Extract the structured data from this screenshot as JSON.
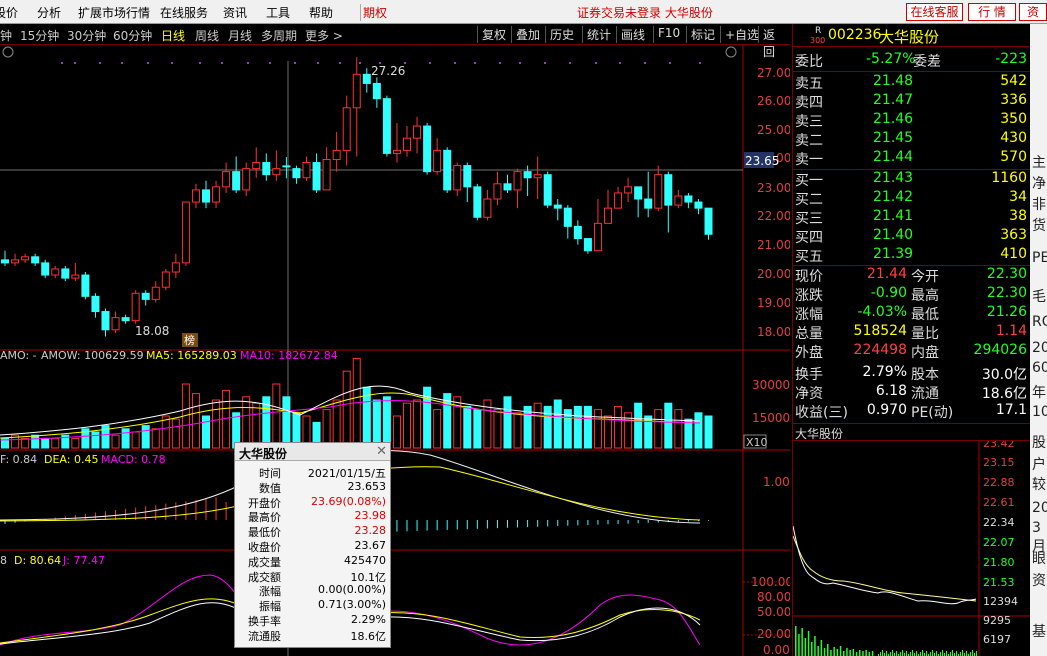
{
  "menu": {
    "items": [
      "股价",
      "分析",
      "扩展市场行情",
      "在线服务",
      "资讯",
      "工具",
      "帮助",
      "期权"
    ],
    "notice": "证券交易未登录 大华股份",
    "online_btn": "在线客服",
    "quote_btn": "行 情",
    "info_btn": "资"
  },
  "periods": [
    "钟",
    "15分钟",
    "30分钟",
    "60分钟",
    "日线",
    "周线",
    "月线",
    "多周期",
    "更多 >"
  ],
  "toolbar": [
    "复权",
    "叠加",
    "历史",
    "统计",
    "画线",
    "F10",
    "标记",
    "+自选",
    "返回"
  ],
  "stock": {
    "code": "002236",
    "name": "大华股份",
    "badge_r": "R",
    "badge_n": "300"
  },
  "order_ratio": {
    "label1": "委比",
    "v1": "-5.27%",
    "label2": "委差",
    "v2": "-223"
  },
  "sell": [
    {
      "label": "卖五",
      "price": "21.48",
      "vol": "542"
    },
    {
      "label": "卖四",
      "price": "21.47",
      "vol": "336"
    },
    {
      "label": "卖三",
      "price": "21.46",
      "vol": "350"
    },
    {
      "label": "卖二",
      "price": "21.45",
      "vol": "430"
    },
    {
      "label": "卖一",
      "price": "21.44",
      "vol": "570"
    }
  ],
  "buy": [
    {
      "label": "买一",
      "price": "21.43",
      "vol": "1160"
    },
    {
      "label": "买二",
      "price": "21.42",
      "vol": "34"
    },
    {
      "label": "买三",
      "price": "21.41",
      "vol": "38"
    },
    {
      "label": "买四",
      "price": "21.40",
      "vol": "363"
    },
    {
      "label": "买五",
      "price": "21.39",
      "vol": "410"
    }
  ],
  "stats": [
    {
      "l1": "现价",
      "v1": "21.44",
      "c1": "#ff4040",
      "l2": "今开",
      "v2": "22.30",
      "c2": "#20ff20"
    },
    {
      "l1": "涨跌",
      "v1": "-0.90",
      "c1": "#20ff20",
      "l2": "最高",
      "v2": "22.30",
      "c2": "#20ff20"
    },
    {
      "l1": "涨幅",
      "v1": "-4.03%",
      "c1": "#20ff20",
      "l2": "最低",
      "v2": "21.26",
      "c2": "#20ff20"
    },
    {
      "l1": "总量",
      "v1": "518524",
      "c1": "#ffff00",
      "l2": "量比",
      "v2": "1.14",
      "c2": "#ff4040"
    },
    {
      "l1": "外盘",
      "v1": "224498",
      "c1": "#ff4040",
      "l2": "内盘",
      "v2": "294026",
      "c2": "#20ff20"
    },
    {
      "l1": "换手",
      "v1": "2.79%",
      "c1": "#ffffff",
      "l2": "股本",
      "v2": "30.0亿",
      "c2": "#ffffff"
    },
    {
      "l1": "净资",
      "v1": "6.18",
      "c1": "#ffffff",
      "l2": "流通",
      "v2": "18.6亿",
      "c2": "#ffffff"
    },
    {
      "l1": "收益(三)",
      "v1": "0.970",
      "c1": "#ffffff",
      "l2": "PE(动)",
      "v2": "17.1",
      "c2": "#ffffff"
    }
  ],
  "mini_title": "大华股份",
  "mini_axis": [
    "23.42",
    "23.15",
    "22.88",
    "22.61",
    "22.34",
    "22.07",
    "21.80",
    "21.53"
  ],
  "mini_vol_axis": [
    "12394",
    "9295",
    "6197"
  ],
  "right_panel": [
    "主",
    "净",
    "非",
    "货",
    "PE",
    "毛",
    "RO",
    "20",
    "60",
    "年",
    "10",
    "股",
    "户",
    "较",
    "20",
    "3月",
    "眼",
    "资",
    "基"
  ],
  "price_axis": [
    "27.00",
    "26.00",
    "25.00",
    "24.00",
    "23.00",
    "22.00",
    "21.00",
    "20.00",
    "19.00",
    "18.00"
  ],
  "cursor_price": "23.65",
  "high_label": "27.26",
  "low_label": "18.08",
  "bang": "榜",
  "vol_header": {
    "name": "AMO: -",
    "amow": "AMOW: 100629.59",
    "ma5": "MA5: 165289.03",
    "ma10": "MA10: 182672.84"
  },
  "vol_axis": [
    "30000",
    "15000"
  ],
  "vol_unit": "X10",
  "macd_header": {
    "dif": "F: 0.84",
    "dea": "DEA: 0.45",
    "macd": "MACD: 0.78"
  },
  "macd_axis": [
    "1.00"
  ],
  "kdj_header": {
    "k": "8",
    "d": "D: 80.64",
    "j": "J: 77.47"
  },
  "kdj_axis": [
    "100.00",
    "80.00",
    "50.00",
    "20.00",
    "0.00"
  ],
  "popup": {
    "title": "大华股份",
    "rows": [
      {
        "k": "时间",
        "v": "2021/01/15/五",
        "c": "#000"
      },
      {
        "k": "数值",
        "v": "23.653",
        "c": "#000"
      },
      {
        "k": "开盘价",
        "v": "23.69(0.08%)",
        "c": "#d00"
      },
      {
        "k": "最高价",
        "v": "23.98",
        "c": "#d00"
      },
      {
        "k": "最低价",
        "v": "23.28",
        "c": "#d00"
      },
      {
        "k": "收盘价",
        "v": "23.67",
        "c": "#000"
      },
      {
        "k": "成交量",
        "v": "425470",
        "c": "#000"
      },
      {
        "k": "成交额",
        "v": "10.1亿",
        "c": "#000"
      },
      {
        "k": "涨幅",
        "v": "0.00(0.00%)",
        "c": "#000"
      },
      {
        "k": "振幅",
        "v": "0.71(3.00%)",
        "c": "#000"
      },
      {
        "k": "换手率",
        "v": "2.29%",
        "c": "#000"
      },
      {
        "k": "流通股",
        "v": "18.6亿",
        "c": "#000"
      }
    ]
  },
  "chart_data": {
    "type": "candlestick",
    "candles": [
      [
        20.6,
        20.5,
        20.9,
        20.4
      ],
      [
        20.5,
        20.6,
        20.8,
        20.4
      ],
      [
        20.6,
        20.7,
        20.8,
        20.5
      ],
      [
        20.7,
        20.5,
        20.8,
        20.4
      ],
      [
        20.5,
        20.1,
        20.6,
        20.0
      ],
      [
        20.1,
        20.3,
        20.4,
        20.0
      ],
      [
        20.3,
        20.0,
        20.4,
        19.9
      ],
      [
        20.0,
        20.1,
        20.5,
        19.9
      ],
      [
        20.1,
        19.4,
        20.2,
        19.3
      ],
      [
        19.4,
        18.9,
        19.5,
        18.7
      ],
      [
        18.9,
        18.3,
        19.0,
        18.08
      ],
      [
        18.3,
        18.7,
        18.9,
        18.2
      ],
      [
        18.7,
        18.6,
        18.8,
        18.5
      ],
      [
        18.6,
        19.5,
        19.6,
        18.5
      ],
      [
        19.5,
        19.3,
        19.6,
        19.1
      ],
      [
        19.3,
        19.7,
        19.9,
        19.2
      ],
      [
        19.7,
        20.2,
        20.3,
        19.6
      ],
      [
        20.2,
        20.5,
        20.8,
        20.0
      ],
      [
        20.5,
        22.5,
        22.5,
        20.4
      ],
      [
        22.5,
        22.9,
        23.1,
        22.3
      ],
      [
        22.9,
        22.5,
        23.2,
        22.3
      ],
      [
        22.5,
        23.0,
        23.2,
        22.3
      ],
      [
        23.0,
        23.5,
        23.8,
        22.8
      ],
      [
        23.5,
        22.9,
        24.0,
        22.8
      ],
      [
        22.9,
        23.6,
        23.8,
        22.7
      ],
      [
        23.6,
        23.8,
        24.3,
        23.3
      ],
      [
        23.8,
        23.4,
        24.1,
        23.2
      ],
      [
        23.4,
        23.6,
        24.2,
        23.2
      ],
      [
        23.69,
        23.67,
        23.98,
        23.28
      ],
      [
        23.6,
        23.3,
        23.7,
        23.1
      ],
      [
        23.3,
        23.8,
        24.0,
        23.2
      ],
      [
        23.8,
        22.9,
        24.1,
        22.8
      ],
      [
        22.9,
        23.9,
        24.3,
        22.9
      ],
      [
        23.9,
        24.2,
        24.8,
        23.5
      ],
      [
        24.2,
        25.6,
        26.0,
        23.7
      ],
      [
        25.6,
        26.7,
        27.26,
        24.0
      ],
      [
        26.7,
        26.4,
        26.9,
        26.1
      ],
      [
        26.4,
        25.9,
        26.6,
        25.6
      ],
      [
        25.9,
        24.1,
        26.0,
        24.0
      ],
      [
        24.1,
        24.2,
        25.1,
        23.8
      ],
      [
        24.2,
        24.6,
        25.0,
        24.0
      ],
      [
        24.6,
        25.0,
        25.3,
        24.1
      ],
      [
        25.0,
        23.5,
        25.1,
        23.4
      ],
      [
        23.5,
        24.2,
        24.6,
        23.4
      ],
      [
        24.2,
        22.9,
        24.3,
        22.8
      ],
      [
        22.9,
        23.7,
        23.8,
        22.7
      ],
      [
        23.7,
        23.0,
        23.8,
        22.5
      ],
      [
        23.0,
        22.0,
        23.1,
        21.9
      ],
      [
        22.0,
        22.6,
        22.9,
        21.9
      ],
      [
        22.6,
        23.1,
        23.5,
        22.4
      ],
      [
        23.1,
        22.9,
        23.4,
        22.8
      ],
      [
        22.9,
        23.5,
        23.6,
        22.3
      ],
      [
        23.5,
        23.3,
        23.7,
        22.7
      ],
      [
        23.3,
        23.4,
        24.0,
        22.6
      ],
      [
        23.4,
        22.4,
        23.5,
        22.3
      ],
      [
        22.4,
        22.3,
        22.6,
        21.9
      ],
      [
        22.3,
        21.7,
        22.4,
        21.3
      ],
      [
        21.7,
        21.3,
        21.9,
        21.1
      ],
      [
        21.3,
        20.9,
        21.3,
        20.8
      ],
      [
        20.9,
        21.8,
        22.6,
        20.9
      ],
      [
        21.8,
        22.3,
        22.9,
        22.0
      ],
      [
        22.3,
        22.8,
        23.0,
        22.4
      ],
      [
        22.8,
        23.0,
        23.3,
        22.5
      ],
      [
        23.0,
        22.6,
        23.0,
        22.0
      ],
      [
        22.6,
        22.3,
        23.5,
        22.0
      ],
      [
        22.3,
        23.4,
        23.7,
        22.2
      ],
      [
        23.4,
        22.4,
        23.5,
        21.5
      ],
      [
        22.4,
        22.7,
        22.9,
        22.3
      ],
      [
        22.7,
        22.5,
        22.8,
        22.3
      ],
      [
        22.5,
        22.3,
        22.6,
        22.1
      ],
      [
        22.3,
        21.44,
        22.3,
        21.26
      ]
    ],
    "volumes": [
      3,
      4,
      3,
      4,
      3,
      3,
      4,
      3,
      6,
      5,
      7,
      4,
      6,
      5,
      7,
      6,
      10,
      9,
      20,
      17,
      10,
      15,
      18,
      11,
      16,
      14,
      16,
      20,
      16,
      11,
      10,
      8,
      12,
      15,
      24,
      28,
      19,
      15,
      16,
      10,
      14,
      15,
      19,
      12,
      17,
      16,
      13,
      12,
      15,
      12,
      16,
      11,
      13,
      14,
      13,
      15,
      12,
      13,
      13,
      12,
      10,
      13,
      11,
      14,
      10,
      12,
      14,
      12,
      9,
      11,
      10
    ],
    "ylim": [
      17.8,
      27.5
    ]
  }
}
